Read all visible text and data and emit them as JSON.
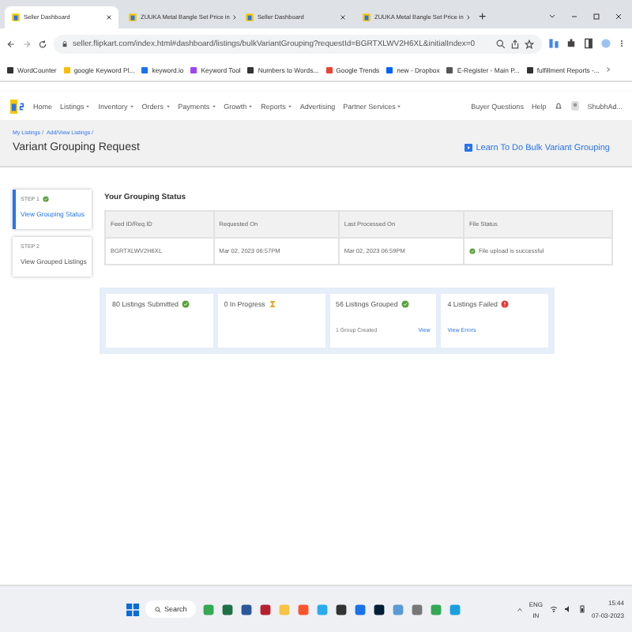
{
  "browser": {
    "tabs": [
      {
        "title": "Seller Dashboard",
        "selected": true
      },
      {
        "title": "ZUUKA Metal Bangle Set Price in",
        "selected": false
      },
      {
        "title": "Seller Dashboard",
        "selected": false
      },
      {
        "title": "ZUUKA Metal Bangle Set Price in",
        "selected": false
      }
    ],
    "new_tab": "+",
    "url": "seller.flipkart.com/index.html#dashboard/listings/bulkVariantGrouping?requestId=BGRTXLWV2H6XL&initialIndex=0",
    "bookmarks": [
      "WordCounter",
      "google Keyword Pl...",
      "keyword.io",
      "Keyword Tool",
      "Numbers to Words...",
      "Google Trends",
      "new - Dropbox",
      "E-Register - Main P...",
      "fulfillment Reports -..."
    ]
  },
  "nav": {
    "items": [
      {
        "label": "Home",
        "dropdown": false
      },
      {
        "label": "Listings",
        "dropdown": true
      },
      {
        "label": "Inventory",
        "dropdown": true
      },
      {
        "label": "Orders",
        "dropdown": true
      },
      {
        "label": "Payments",
        "dropdown": true
      },
      {
        "label": "Growth",
        "dropdown": true
      },
      {
        "label": "Reports",
        "dropdown": true
      },
      {
        "label": "Advertising",
        "dropdown": false
      },
      {
        "label": "Partner Services",
        "dropdown": true
      }
    ],
    "right": [
      "Buyer Questions",
      "Help"
    ],
    "user": "ShubhAd..."
  },
  "breadcrumbs": [
    "My Listings /",
    "Add/View Listings /"
  ],
  "title": "Variant Grouping Request",
  "learn_link": "Learn To Do Bulk Variant Grouping",
  "steps": [
    {
      "step": "STEP 1",
      "label": "View Grouping Status",
      "done": true,
      "selected": true
    },
    {
      "step": "STEP 2",
      "label": "View Grouped Listings",
      "done": false,
      "selected": false
    }
  ],
  "status": {
    "heading": "Your Grouping Status",
    "columns": [
      "Feed ID/Req.ID",
      "Requested On",
      "Last Processed On",
      "File Status"
    ],
    "rows": [
      [
        "BGRTXLWV2H6XL",
        "Mar 02, 2023 06:57PM",
        "Mar 02, 2023 06:59PM",
        "File upload is successful"
      ]
    ]
  },
  "summary": [
    {
      "count": "80",
      "label": "Listings Submitted",
      "kind": "success"
    },
    {
      "count": "0",
      "label": "In Progress",
      "kind": "pending"
    },
    {
      "count": "56",
      "label": "Listings Grouped",
      "kind": "success",
      "note": "1 Group Created",
      "link": "View"
    },
    {
      "count": "4",
      "label": "Listings Failed",
      "kind": "error",
      "link": "View Errors"
    }
  ],
  "taskbar": {
    "search": "Search",
    "lang": "ENG",
    "region": "IN",
    "time": "15:44",
    "date": "07-03-2023"
  }
}
